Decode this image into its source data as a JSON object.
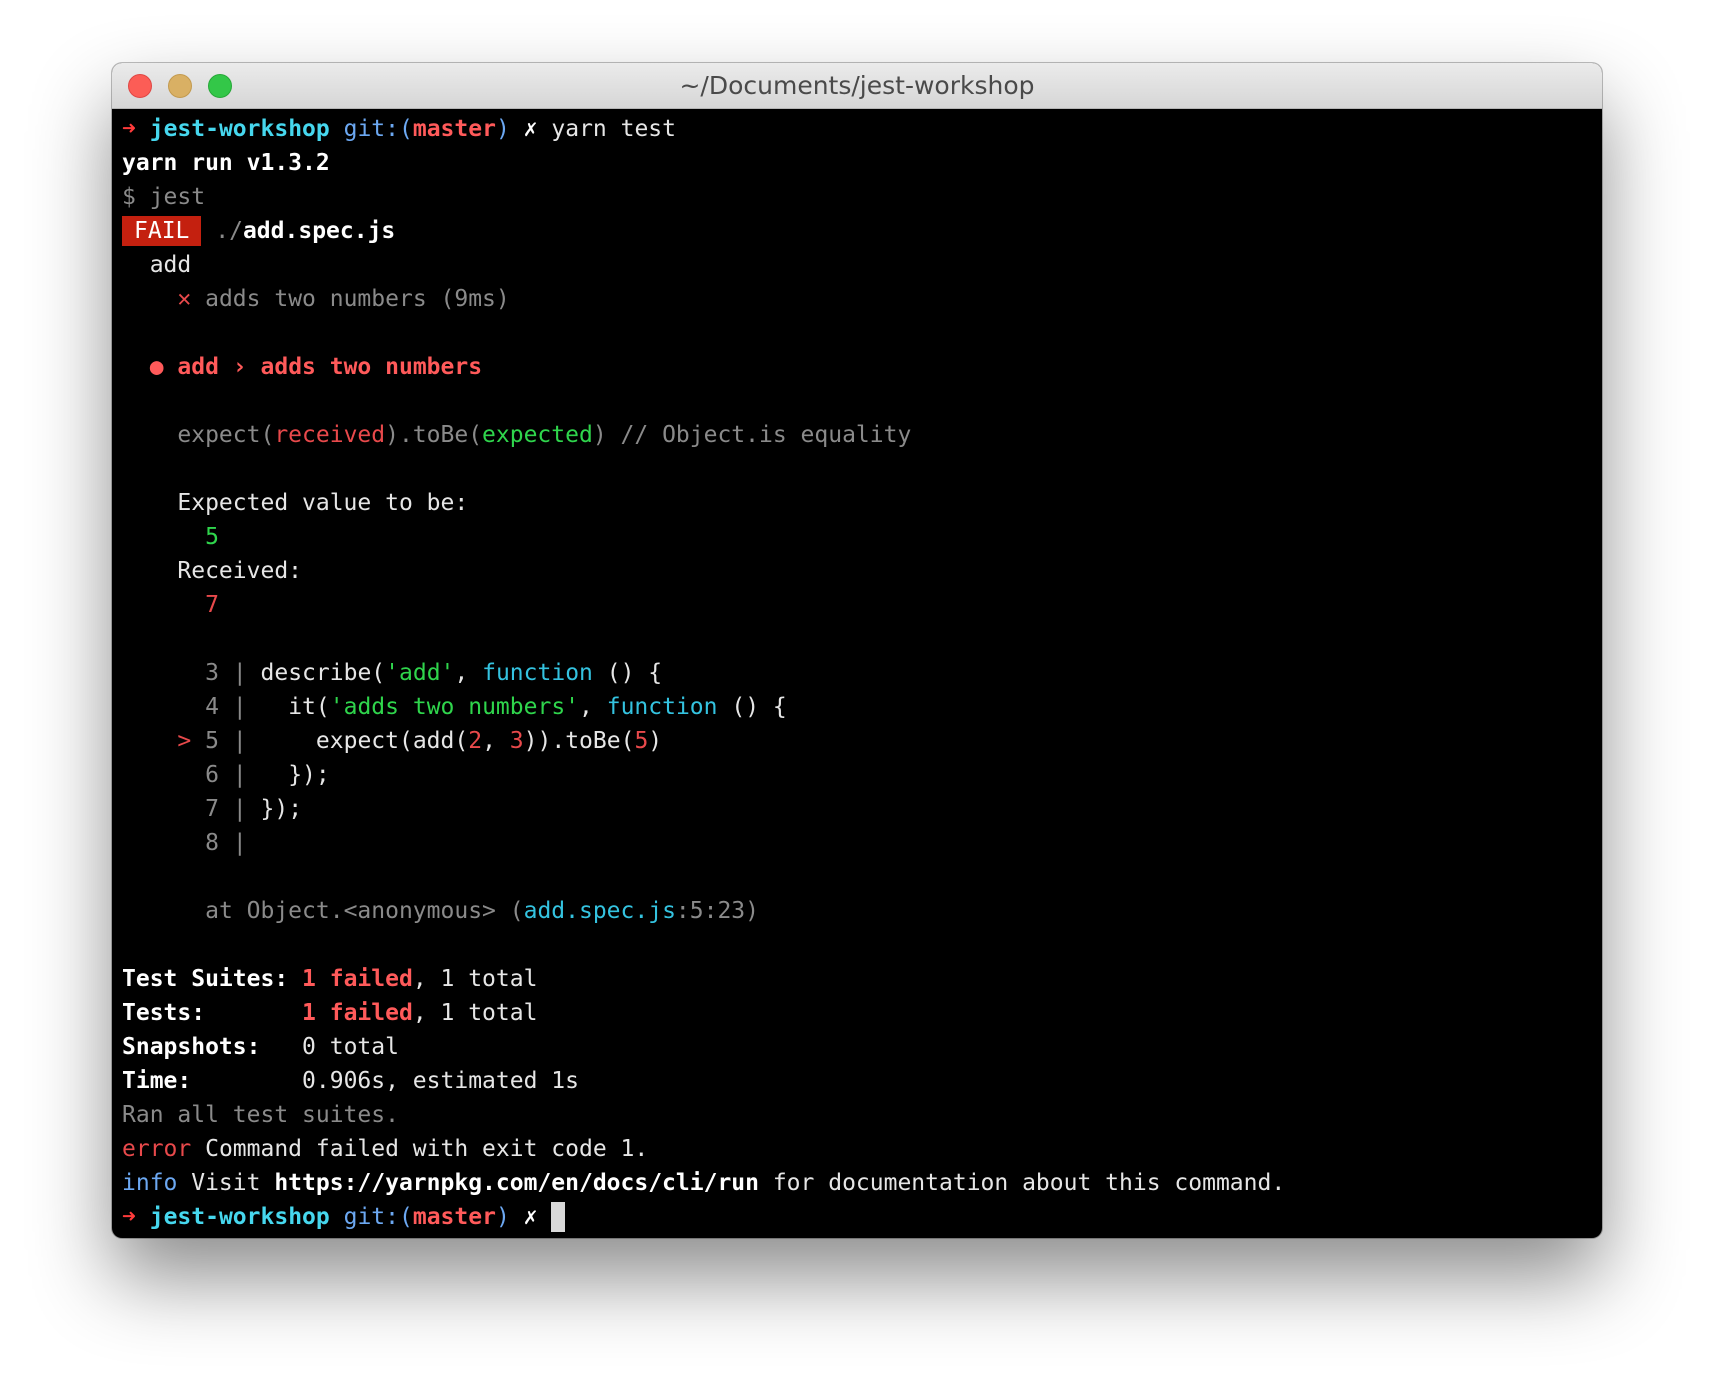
{
  "window": {
    "title": "~/Documents/jest-workshop"
  },
  "prompt": {
    "arrow": "➜",
    "dir": "jest-workshop",
    "git_prefix": "git:(",
    "branch": "master",
    "git_suffix": ")",
    "dirty": "✗"
  },
  "session": {
    "command": "yarn test",
    "yarn_version": "yarn run v1.3.2",
    "dollar_cmd": "$ jest",
    "fail_badge": "FAIL",
    "file_prefix": "./",
    "file_name": "add.spec.js",
    "describe_name": "add",
    "test_fail_icon": "✕",
    "test_result": "adds two numbers (9ms)",
    "bullet": "●",
    "error_title": "add › adds two numbers",
    "expect_prefix": "expect(",
    "expect_received": "received",
    "expect_mid": ").toBe(",
    "expect_expected": "expected",
    "expect_suffix": ") // Object.is equality",
    "expected_label": "Expected value to be:",
    "expected_value": "5",
    "received_label": "Received:",
    "received_value": "7",
    "code_lines": [
      {
        "marker": " ",
        "num": "3",
        "sep": " |",
        "content": " describe('add', function () {"
      },
      {
        "marker": " ",
        "num": "4",
        "sep": " |",
        "content": "   it('adds two numbers', function () {"
      },
      {
        "marker": ">",
        "num": "5",
        "sep": " |",
        "content": "     expect(add(2, 3)).toBe(5)"
      },
      {
        "marker": " ",
        "num": "6",
        "sep": " |",
        "content": "   });"
      },
      {
        "marker": " ",
        "num": "7",
        "sep": " |",
        "content": " });"
      },
      {
        "marker": " ",
        "num": "8",
        "sep": " |",
        "content": ""
      }
    ],
    "stack_prefix": "at Object.<anonymous> (",
    "stack_file": "add.spec.js",
    "stack_loc": ":5:23)",
    "summary": {
      "suites_label": "Test Suites:",
      "suites_failed": "1 failed",
      "suites_total": ", 1 total",
      "tests_label": "Tests:",
      "tests_failed": "1 failed",
      "tests_total": ", 1 total",
      "snapshots_label": "Snapshots:",
      "snapshots_value": "0 total",
      "time_label": "Time:",
      "time_value": "0.906s, estimated 1s"
    },
    "ran_all": "Ran all test suites.",
    "error_label": "error",
    "error_msg": " Command failed with exit code 1.",
    "info_label": "info",
    "info_visit": " Visit ",
    "info_url": "https://yarnpkg.com/en/docs/cli/run",
    "info_suffix": " for documentation about this command."
  },
  "colors": {
    "fail_badge_bg": "#c4200f",
    "prompt_arrow": "#ff3b3b",
    "dir": "#46d7ee",
    "git": "#6ca8f2",
    "branch": "#ff5a5a",
    "pass_green": "#2fd54c",
    "error_red": "#e8494b"
  }
}
